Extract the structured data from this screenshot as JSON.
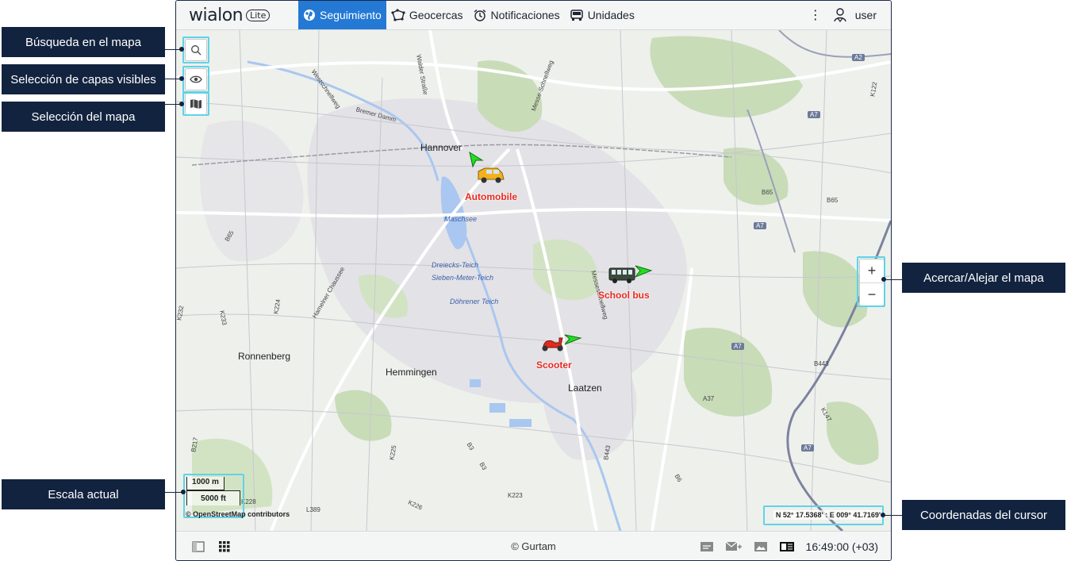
{
  "app": {
    "logo_text": "wialon",
    "logo_badge": "Lite",
    "nav": [
      {
        "label": "Seguimiento",
        "icon": "globe-icon",
        "active": true
      },
      {
        "label": "Geocercas",
        "icon": "geofence-icon",
        "active": false
      },
      {
        "label": "Notificaciones",
        "icon": "alarm-clock-icon",
        "active": false
      },
      {
        "label": "Unidades",
        "icon": "vehicle-icon",
        "active": false
      }
    ],
    "user": "user",
    "accent_color": "#2379d4"
  },
  "map": {
    "places": [
      "Hannover",
      "Ronnenberg",
      "Hemmingen",
      "Laatzen"
    ],
    "water_labels": [
      "Maschsee",
      "Dreiecks-Teich",
      "Sieben-Meter-Teich",
      "Döhrener Teich"
    ],
    "road_labels": [
      "Walder Straße",
      "Westschnellweg",
      "Bremer Damm",
      "Messe-Schnellweg",
      "Hamelner Chaussee",
      "Messeschnellweg"
    ],
    "shields": [
      "A2",
      "A7",
      "B65",
      "B3",
      "B443",
      "A37",
      "K122",
      "K147",
      "B6",
      "K224",
      "K233",
      "K232",
      "B217",
      "K225",
      "K226",
      "K223",
      "L389",
      "K228"
    ],
    "units": [
      {
        "name": "Automobile",
        "icon": "car-icon",
        "label_color": "#e8281f"
      },
      {
        "name": "School bus",
        "icon": "bus-icon",
        "label_color": "#e8281f"
      },
      {
        "name": "Scooter",
        "icon": "scooter-icon",
        "label_color": "#e8281f"
      }
    ],
    "scale_metric": "1000 m",
    "scale_imperial": "5000 ft",
    "attribution": "© OpenStreetMap contributors",
    "cursor_coords": "N 52° 17.5368' : E 009° 41.7169'",
    "zoom_in": "+",
    "zoom_out": "−"
  },
  "bottom": {
    "copyright": "© Gurtam",
    "time": "16:49:00 (+03)"
  },
  "callouts": {
    "search": "Búsqueda en el mapa",
    "layers": "Selección de capas visibles",
    "map_select": "Selección del mapa",
    "scale": "Escala actual",
    "zoom": "Acercar/Alejar el mapa",
    "coords": "Coordenadas del cursor"
  }
}
